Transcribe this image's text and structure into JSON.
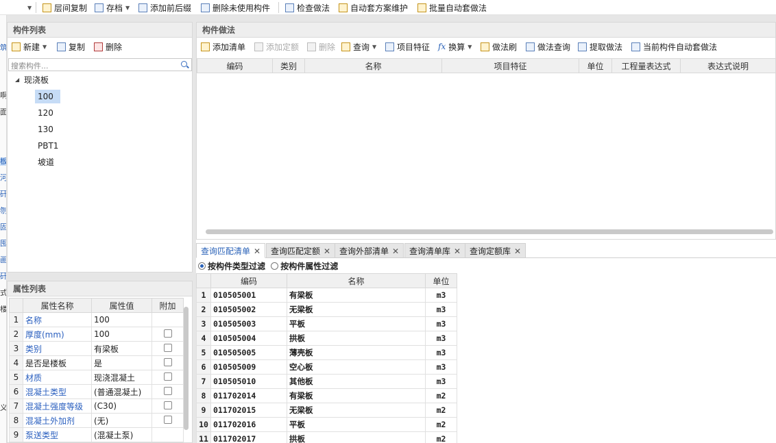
{
  "toolbar": {
    "items": [
      "层间复制",
      "存档",
      "添加前后缀",
      "删除未使用构件",
      "检查做法",
      "自动套方案维护",
      "批量自动套做法"
    ]
  },
  "strip_chars": [
    "筑",
    "啊",
    "板",
    "面",
    "河",
    "矸",
    "刎",
    "固",
    "囤",
    "画",
    "矸",
    "式",
    "楼",
    "义"
  ],
  "component_list": {
    "title": "构件列表",
    "new_label": "新建",
    "copy_label": "复制",
    "delete_label": "删除",
    "search_placeholder": "搜索构件...",
    "tree_root": "现浇板",
    "tree_items": [
      "100",
      "120",
      "130",
      "PBT1",
      "坡道"
    ]
  },
  "props": {
    "title": "属性列表",
    "headers": [
      "属性名称",
      "属性值",
      "附加"
    ],
    "rows": [
      {
        "n": "1",
        "name": "名称",
        "value": "100"
      },
      {
        "n": "2",
        "name": "厚度(mm)",
        "value": "100"
      },
      {
        "n": "3",
        "name": "类别",
        "value": "有梁板"
      },
      {
        "n": "4",
        "name": "是否是楼板",
        "value": "是"
      },
      {
        "n": "5",
        "name": "材质",
        "value": "现浇混凝土"
      },
      {
        "n": "6",
        "name": "混凝土类型",
        "value": "(普通混凝土)"
      },
      {
        "n": "7",
        "name": "混凝土强度等级",
        "value": "(C30)"
      },
      {
        "n": "8",
        "name": "混凝土外加剂",
        "value": "(无)"
      },
      {
        "n": "9",
        "name": "泵送类型",
        "value": "(混凝土泵)"
      }
    ]
  },
  "methods": {
    "title": "构件做法",
    "toolbar": [
      "添加清单",
      "添加定额",
      "删除",
      "查询",
      "项目特征",
      "换算",
      "做法刷",
      "做法查询",
      "提取做法",
      "当前构件自动套做法"
    ],
    "headers": [
      "编码",
      "类别",
      "名称",
      "项目特征",
      "单位",
      "工程量表达式",
      "表达式说明"
    ]
  },
  "query": {
    "tabs": [
      "查询匹配清单",
      "查询匹配定额",
      "查询外部清单",
      "查询清单库",
      "查询定额库"
    ],
    "filter_type": "按构件类型过滤",
    "filter_attr": "按构件属性过滤",
    "headers": [
      "编码",
      "名称",
      "单位"
    ],
    "rows": [
      {
        "n": "1",
        "code": "010505001",
        "name": "有梁板",
        "unit": "m3"
      },
      {
        "n": "2",
        "code": "010505002",
        "name": "无梁板",
        "unit": "m3"
      },
      {
        "n": "3",
        "code": "010505003",
        "name": "平板",
        "unit": "m3"
      },
      {
        "n": "4",
        "code": "010505004",
        "name": "拱板",
        "unit": "m3"
      },
      {
        "n": "5",
        "code": "010505005",
        "name": "薄壳板",
        "unit": "m3"
      },
      {
        "n": "6",
        "code": "010505009",
        "name": "空心板",
        "unit": "m3"
      },
      {
        "n": "7",
        "code": "010505010",
        "name": "其他板",
        "unit": "m3"
      },
      {
        "n": "8",
        "code": "011702014",
        "name": "有梁板",
        "unit": "m2"
      },
      {
        "n": "9",
        "code": "011702015",
        "name": "无梁板",
        "unit": "m2"
      },
      {
        "n": "10",
        "code": "011702016",
        "name": "平板",
        "unit": "m2"
      },
      {
        "n": "11",
        "code": "011702017",
        "name": "拱板",
        "unit": "m2"
      }
    ]
  }
}
